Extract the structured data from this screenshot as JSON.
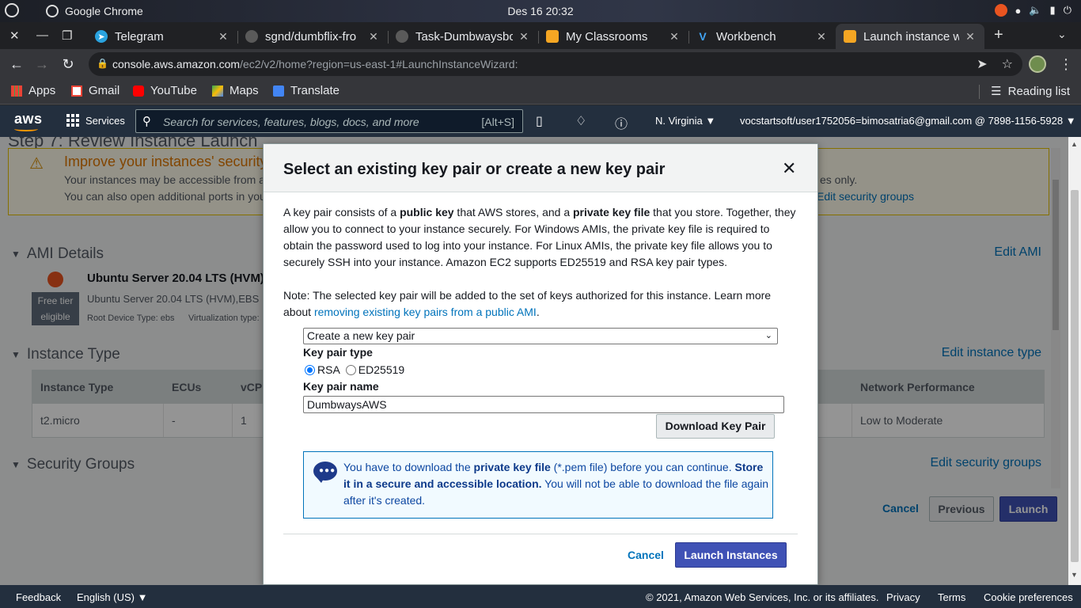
{
  "os": {
    "app_name": "Google Chrome",
    "clock": "Des 16  20:32",
    "tray_icons": [
      "ubuntu-badge-icon",
      "wifi-icon",
      "volume-icon",
      "battery-icon",
      "power-icon"
    ]
  },
  "tabs": [
    {
      "title": "Telegram",
      "icon": "telegram-icon",
      "color": "#2aa3df"
    },
    {
      "title": "sgnd/dumbflix-fro",
      "icon": "github-icon",
      "color": "#3a3a3a"
    },
    {
      "title": "Task-Dumbwaysbc",
      "icon": "github-icon",
      "color": "#3a3a3a"
    },
    {
      "title": "My Classrooms",
      "icon": "aws-box-icon",
      "color": "#f5a623"
    },
    {
      "title": "Workbench",
      "icon": "vocareum-icon",
      "color": "#1565c0"
    },
    {
      "title": "Launch instance w",
      "icon": "aws-box-icon",
      "color": "#f5a623"
    }
  ],
  "address_bar": {
    "host": "console.aws.amazon.com",
    "path": "/ec2/v2/home?region=us-east-1#LaunchInstanceWizard:"
  },
  "bookmarks": [
    {
      "label": "Apps",
      "icon": "apps-grid-icon"
    },
    {
      "label": "Gmail",
      "icon": "gmail-icon"
    },
    {
      "label": "YouTube",
      "icon": "youtube-icon"
    },
    {
      "label": "Maps",
      "icon": "maps-icon"
    },
    {
      "label": "Translate",
      "icon": "translate-icon"
    }
  ],
  "reading_list": "Reading list",
  "aws_nav": {
    "logo": "aws",
    "services": "Services",
    "search_placeholder": "Search for services, features, blogs, docs, and more",
    "search_shortcut": "[Alt+S]",
    "region": "N. Virginia",
    "account": "vocstartsoft/user1752056=bimosatria6@gmail.com @ 7898-1156-5928"
  },
  "background": {
    "step_title": "Step 7: Review Instance Launch",
    "warning_title": "Improve your instances' security",
    "warning_line1": "Your instances may be accessible from a",
    "warning_line2": "You can also open additional ports in you",
    "warning_tail": "es only.",
    "warning_link": "Edit security groups",
    "ami_section": "AMI Details",
    "ami_edit": "Edit AMI",
    "ami_name": "Ubuntu Server 20.04 LTS (HVM)",
    "ami_free_tier": "Free tier eligible",
    "ami_desc": "Ubuntu Server 20.04 LTS (HVM),EBS",
    "ami_root": "Root Device Type: ebs",
    "ami_virt": "Virtualization type:",
    "instance_section": "Instance Type",
    "instance_edit": "Edit instance type",
    "table_headers": [
      "Instance Type",
      "ECUs",
      "vCPU",
      "Network Performance"
    ],
    "table_row": [
      "t2.micro",
      "-",
      "1",
      "Low to Moderate"
    ],
    "security_section": "Security Groups",
    "security_edit": "Edit security groups",
    "cancel": "Cancel",
    "previous": "Previous",
    "launch": "Launch"
  },
  "modal": {
    "title": "Select an existing key pair or create a new key pair",
    "para1_a": "A key pair consists of a ",
    "para1_b": "public key",
    "para1_c": " that AWS stores, and a ",
    "para1_d": "private key file",
    "para1_e": " that you store. Together, they allow you to connect to your instance securely. For Windows AMIs, the private key file is required to obtain the password used to log into your instance. For Linux AMIs, the private key file allows you to securely SSH into your instance. Amazon EC2 supports ED25519 and RSA key pair types.",
    "note_a": "Note: The selected key pair will be added to the set of keys authorized for this instance. Learn more about ",
    "note_link": "removing existing key pairs from a public AMI",
    "note_end": ".",
    "select_value": "Create a new key pair",
    "key_type_label": "Key pair type",
    "radio_rsa": "RSA",
    "radio_ed": "ED25519",
    "key_name_label": "Key pair name",
    "key_name_value": "DumbwaysAWS",
    "download_button": "Download Key Pair",
    "info_a": "You have to download the ",
    "info_b": "private key file",
    "info_c": " (*.pem file) before you can continue. ",
    "info_d": "Store it in a secure and accessible location.",
    "info_e": " You will not be able to download the file again after it's created.",
    "cancel": "Cancel",
    "launch_instances": "Launch Instances"
  },
  "footer": {
    "feedback": "Feedback",
    "language": "English (US)",
    "copyright": "© 2021, Amazon Web Services, Inc. or its affiliates.",
    "privacy": "Privacy",
    "terms": "Terms",
    "cookies": "Cookie preferences"
  }
}
